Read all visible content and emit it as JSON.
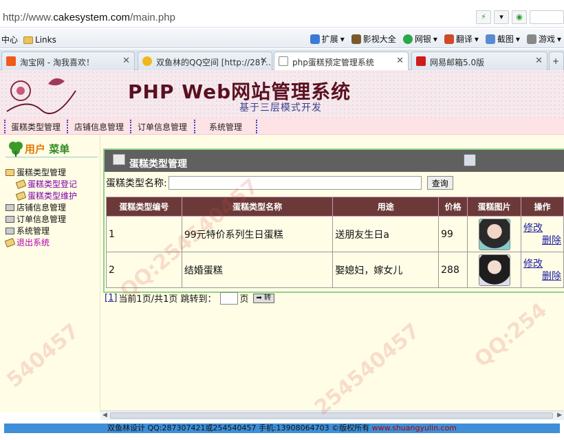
{
  "browser": {
    "url_prefix": "http://www.",
    "url_domain": "cakesystem.com",
    "url_path": "/main.php",
    "bookmarks_left": [
      "中心",
      "Links"
    ],
    "bookmarks_right": [
      "扩展",
      "影视大全",
      "网银",
      "翻译",
      "截图",
      "游戏"
    ],
    "tabs": [
      {
        "title": "淘宝网 - 淘我喜欢！",
        "icon_color": "#f05a1a"
      },
      {
        "title": "双鱼林的QQ空间 [http://287…",
        "icon_color": "#f0b81a"
      },
      {
        "title": "php蛋糕预定管理系统",
        "icon_color": "#ffffff"
      },
      {
        "title": "网易邮箱5.0版",
        "icon_color": "#d01b1b"
      }
    ]
  },
  "header": {
    "title": "PHP Web网站管理系统",
    "subtitle": "基于三层模式开发"
  },
  "nav": [
    "蛋糕类型管理",
    "店铺信息管理",
    "订单信息管理",
    "系统管理"
  ],
  "sidebar": {
    "heading_a": "用户",
    "heading_b": "菜单",
    "items": [
      {
        "label": "蛋糕类型管理"
      },
      {
        "label": "蛋糕类型登记"
      },
      {
        "label": "蛋糕类型维护"
      },
      {
        "label": "店铺信息管理"
      },
      {
        "label": "订单信息管理"
      },
      {
        "label": "系统管理"
      },
      {
        "label": "退出系统"
      }
    ]
  },
  "panel": {
    "title": "蛋糕类型管理",
    "search_label": "蛋糕类型名称:",
    "search_value": "",
    "search_button": "查询"
  },
  "table": {
    "headers": [
      "蛋糕类型编号",
      "蛋糕类型名称",
      "用途",
      "价格",
      "蛋糕图片",
      "操作"
    ],
    "rows": [
      {
        "id": "1",
        "name": "99元特价系列生日蛋糕",
        "use": "送朋友生日a",
        "price": "99",
        "edit": "修改",
        "del": "删除"
      },
      {
        "id": "2",
        "name": "结婚蛋糕",
        "use": "娶媳妇，嫁女儿",
        "price": "288",
        "edit": "修改",
        "del": "删除"
      }
    ]
  },
  "pager": {
    "page_link": "[1]",
    "info": "当前1页/共1页 跳转到：",
    "page_unit": "页",
    "go": "➡ 转"
  },
  "footer": {
    "text": "双鱼林设计 QQ:287307421或254540457 手机:13908064703 ©版权所有 ",
    "site": "www.shuangyulin.com"
  }
}
